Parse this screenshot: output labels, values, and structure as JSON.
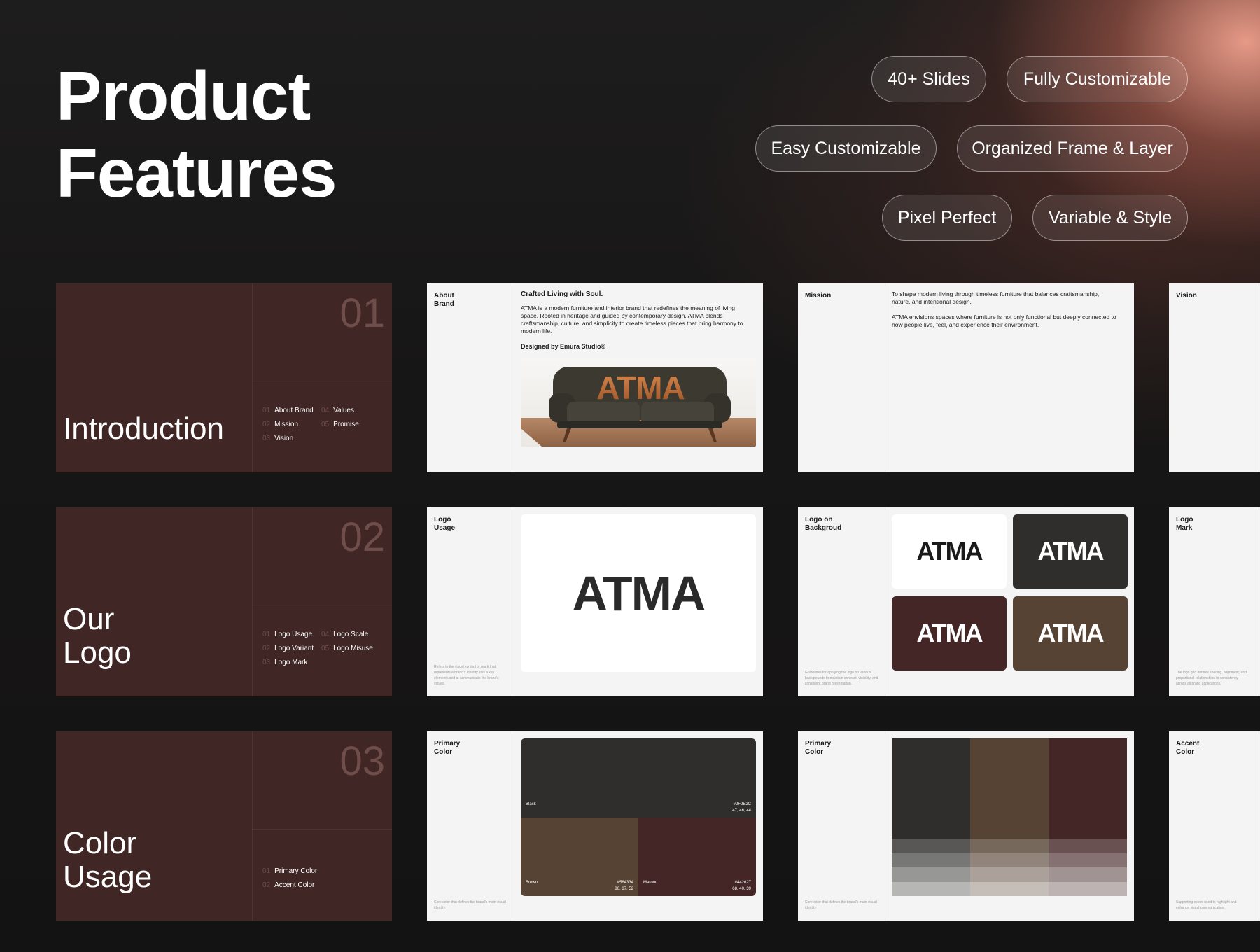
{
  "headline": "Product\nFeatures",
  "pills": [
    {
      "label": "40+ Slides"
    },
    {
      "label": "Fully Customizable"
    },
    {
      "label": "Easy Customizable"
    },
    {
      "label": "Organized Frame & Layer"
    },
    {
      "label": "Pixel Perfect"
    },
    {
      "label": "Variable & Style"
    }
  ],
  "sections": [
    {
      "number": "01",
      "title": "Introduction",
      "items": [
        {
          "n": "01",
          "label": "About Brand"
        },
        {
          "n": "04",
          "label": "Values"
        },
        {
          "n": "02",
          "label": "Mission"
        },
        {
          "n": "05",
          "label": "Promise"
        },
        {
          "n": "03",
          "label": "Vision"
        }
      ]
    },
    {
      "number": "02",
      "title": "Our\nLogo",
      "items": [
        {
          "n": "01",
          "label": "Logo Usage"
        },
        {
          "n": "04",
          "label": "Logo Scale"
        },
        {
          "n": "02",
          "label": "Logo Variant"
        },
        {
          "n": "05",
          "label": "Logo Misuse"
        },
        {
          "n": "03",
          "label": "Logo Mark"
        }
      ]
    },
    {
      "number": "03",
      "title": "Color\nUsage",
      "items": [
        {
          "n": "01",
          "label": "Primary Color"
        },
        {
          "n": "02",
          "label": "Accent Color"
        }
      ]
    }
  ],
  "about": {
    "label": "About\nBrand",
    "title": "Crafted Living with Soul.",
    "body": "ATMA is a modern furniture and interior brand that redefines the meaning of living space. Rooted in heritage and guided by contemporary design, ATMA blends craftsmanship, culture, and simplicity to create timeless pieces that bring harmony to modern life.",
    "signature": "Designed by Emura Studio©",
    "photo_word": "ATMA"
  },
  "mission": {
    "label": "Mission",
    "body": "To shape modern living through timeless furniture that balances craftsmanship, nature, and intentional design.\n\nATMA envisions spaces where furniture is not only functional but deeply connected to how people live, feel, and experience their environment."
  },
  "vision": {
    "label": "Vision"
  },
  "logo_usage": {
    "label": "Logo\nUsage",
    "wordmark": "ATMA",
    "caption": "Refers to the visual symbol or mark that represents a brand's identity. It is a key element used to communicate the brand's values."
  },
  "logo_background": {
    "label": "Logo on\nBackgroud",
    "wordmark": "ATMA",
    "caption": "Guidelines for applying the logo on various backgrounds to maintain contrast, visibility, and consistent brand presentation.",
    "tiles": [
      {
        "bg": "#ffffff",
        "fg": "#1a1a1a"
      },
      {
        "bg": "#2f2e2c",
        "fg": "#ffffff"
      },
      {
        "bg": "#442627",
        "fg": "#ffffff"
      },
      {
        "bg": "#564334",
        "fg": "#ffffff"
      }
    ]
  },
  "logo_mark": {
    "label": "Logo\nMark",
    "caption": "The logo grid defines spacing, alignment, and proportional relationships to consistency across all brand applications."
  },
  "primary_color": {
    "label": "Primary\nColor",
    "caption": "Core color that defines the brand's main visual identity.",
    "swatches": [
      {
        "name": "Black",
        "hex": "#2F2E2C",
        "rgb": "47, 46, 44"
      },
      {
        "name": "Brown",
        "hex": "#564334",
        "rgb": "86, 67, 52"
      },
      {
        "name": "Maroon",
        "hex": "#442627",
        "rgb": "68, 40, 39"
      }
    ]
  },
  "primary_color_tints": {
    "label": "Primary\nColor",
    "caption": "Core color that defines the brand's main visual identity.",
    "columns": [
      "#2f2e2c",
      "#564334",
      "#442627"
    ]
  },
  "accent_color": {
    "label": "Accent\nColor",
    "caption": "Supporting colors used to highlight and enhance visual communication."
  }
}
